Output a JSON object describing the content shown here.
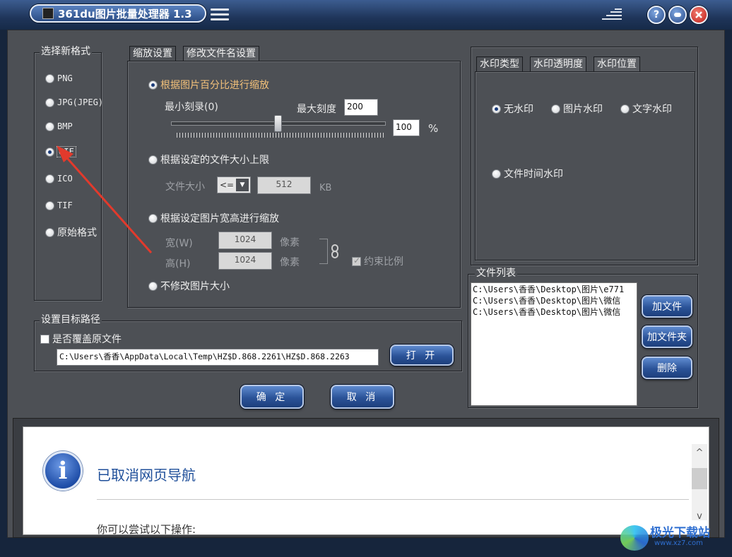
{
  "window": {
    "title": "361du图片批量处理器 1.3",
    "help_label": "?"
  },
  "format_group": {
    "legend": "选择新格式",
    "options": [
      "PNG",
      "JPG(JPEG)",
      "BMP",
      "GIF",
      "ICO",
      "TIF",
      "原始格式"
    ],
    "selected": "GIF"
  },
  "resize_tabs": [
    "缩放设置",
    "修改文件名设置"
  ],
  "resize": {
    "by_percent_label": "根据图片百分比进行缩放",
    "min_scale_label": "最小刻录(0)",
    "max_scale_label": "最大刻度",
    "max_scale_value": "200",
    "percent_value": "100",
    "percent_unit": "%",
    "slider_value": 100,
    "by_filesize_label": "根据设定的文件大小上限",
    "filesize_label": "文件大小",
    "filesize_operator": "<=",
    "filesize_value": "512",
    "filesize_unit": "KB",
    "by_dimensions_label": "根据设定图片宽高进行缩放",
    "width_label": "宽(W)",
    "width_value": "1024",
    "width_unit": "像素",
    "height_label": "高(H)",
    "height_value": "1024",
    "height_unit": "像素",
    "keep_ratio_label": "约束比例",
    "no_resize_label": "不修改图片大小"
  },
  "watermark_tabs": [
    "水印类型",
    "水印透明度",
    "水印位置"
  ],
  "watermark": {
    "options": [
      "无水印",
      "图片水印",
      "文字水印",
      "文件时间水印"
    ],
    "selected": "无水印"
  },
  "file_list": {
    "legend": "文件列表",
    "items": [
      "C:\\Users\\香香\\Desktop\\图片\\e771",
      "C:\\Users\\香香\\Desktop\\图片\\微信",
      "C:\\Users\\香香\\Desktop\\图片\\微信"
    ],
    "add_file_label": "加文件",
    "add_folder_label": "加文件夹",
    "delete_label": "删除"
  },
  "target": {
    "legend": "设置目标路径",
    "overwrite_label": "是否覆盖原文件",
    "path_value": "C:\\Users\\香香\\AppData\\Local\\Temp\\HZ$D.868.2261\\HZ$D.868.2263",
    "open_label": "打 开"
  },
  "dialog": {
    "ok_label": "确 定",
    "cancel_label": "取 消"
  },
  "browser": {
    "info_glyph": "i",
    "title": "已取消网页导航",
    "subtitle": "你可以尝试以下操作:",
    "scroll_up": "^",
    "scroll_down": "v"
  },
  "site_watermark": {
    "name": "极光下载站",
    "url": "www.xz7.com"
  },
  "colors": {
    "accent_blue": "#2b5398",
    "annotation_red": "#e23a2c",
    "panel_bg": "#4d5055"
  }
}
